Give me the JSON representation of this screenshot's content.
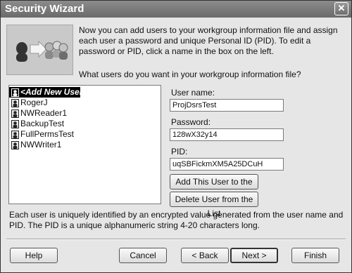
{
  "window": {
    "title": "Security Wizard",
    "close_glyph": "✕"
  },
  "intro_text": "Now you can add users to your workgroup information file and assign each user a password and unique Personal ID (PID). To edit a password or PID, click a name in the box on the left.",
  "question": "What users do you want in your workgroup information file?",
  "users": [
    {
      "label": "<Add New User>",
      "selected": true,
      "icon": "user-icon"
    },
    {
      "label": "RogerJ",
      "selected": false,
      "icon": "user-icon"
    },
    {
      "label": "NWReader1",
      "selected": false,
      "icon": "user-icon"
    },
    {
      "label": "BackupTest",
      "selected": false,
      "icon": "user-icon"
    },
    {
      "label": "FullPermsTest",
      "selected": false,
      "icon": "user-icon"
    },
    {
      "label": "NWWriter1",
      "selected": false,
      "icon": "user-icon"
    }
  ],
  "fields": {
    "username_label": "User name:",
    "username_value": "ProjDsrsTest",
    "password_label": "Password:",
    "password_value": "128wX32y14",
    "pid_label": "PID:",
    "pid_value": "uqSBFickmXM5A25DCuH"
  },
  "actions": {
    "add_label": "Add This User to the List",
    "delete_label": "Delete User from the List"
  },
  "footnote": "Each user is uniquely identified by an encrypted value generated from the user name and PID. The PID is a unique alphanumeric string 4-20 characters long.",
  "nav": {
    "help": "Help",
    "cancel": "Cancel",
    "back": "< Back",
    "next": "Next >",
    "finish": "Finish"
  }
}
